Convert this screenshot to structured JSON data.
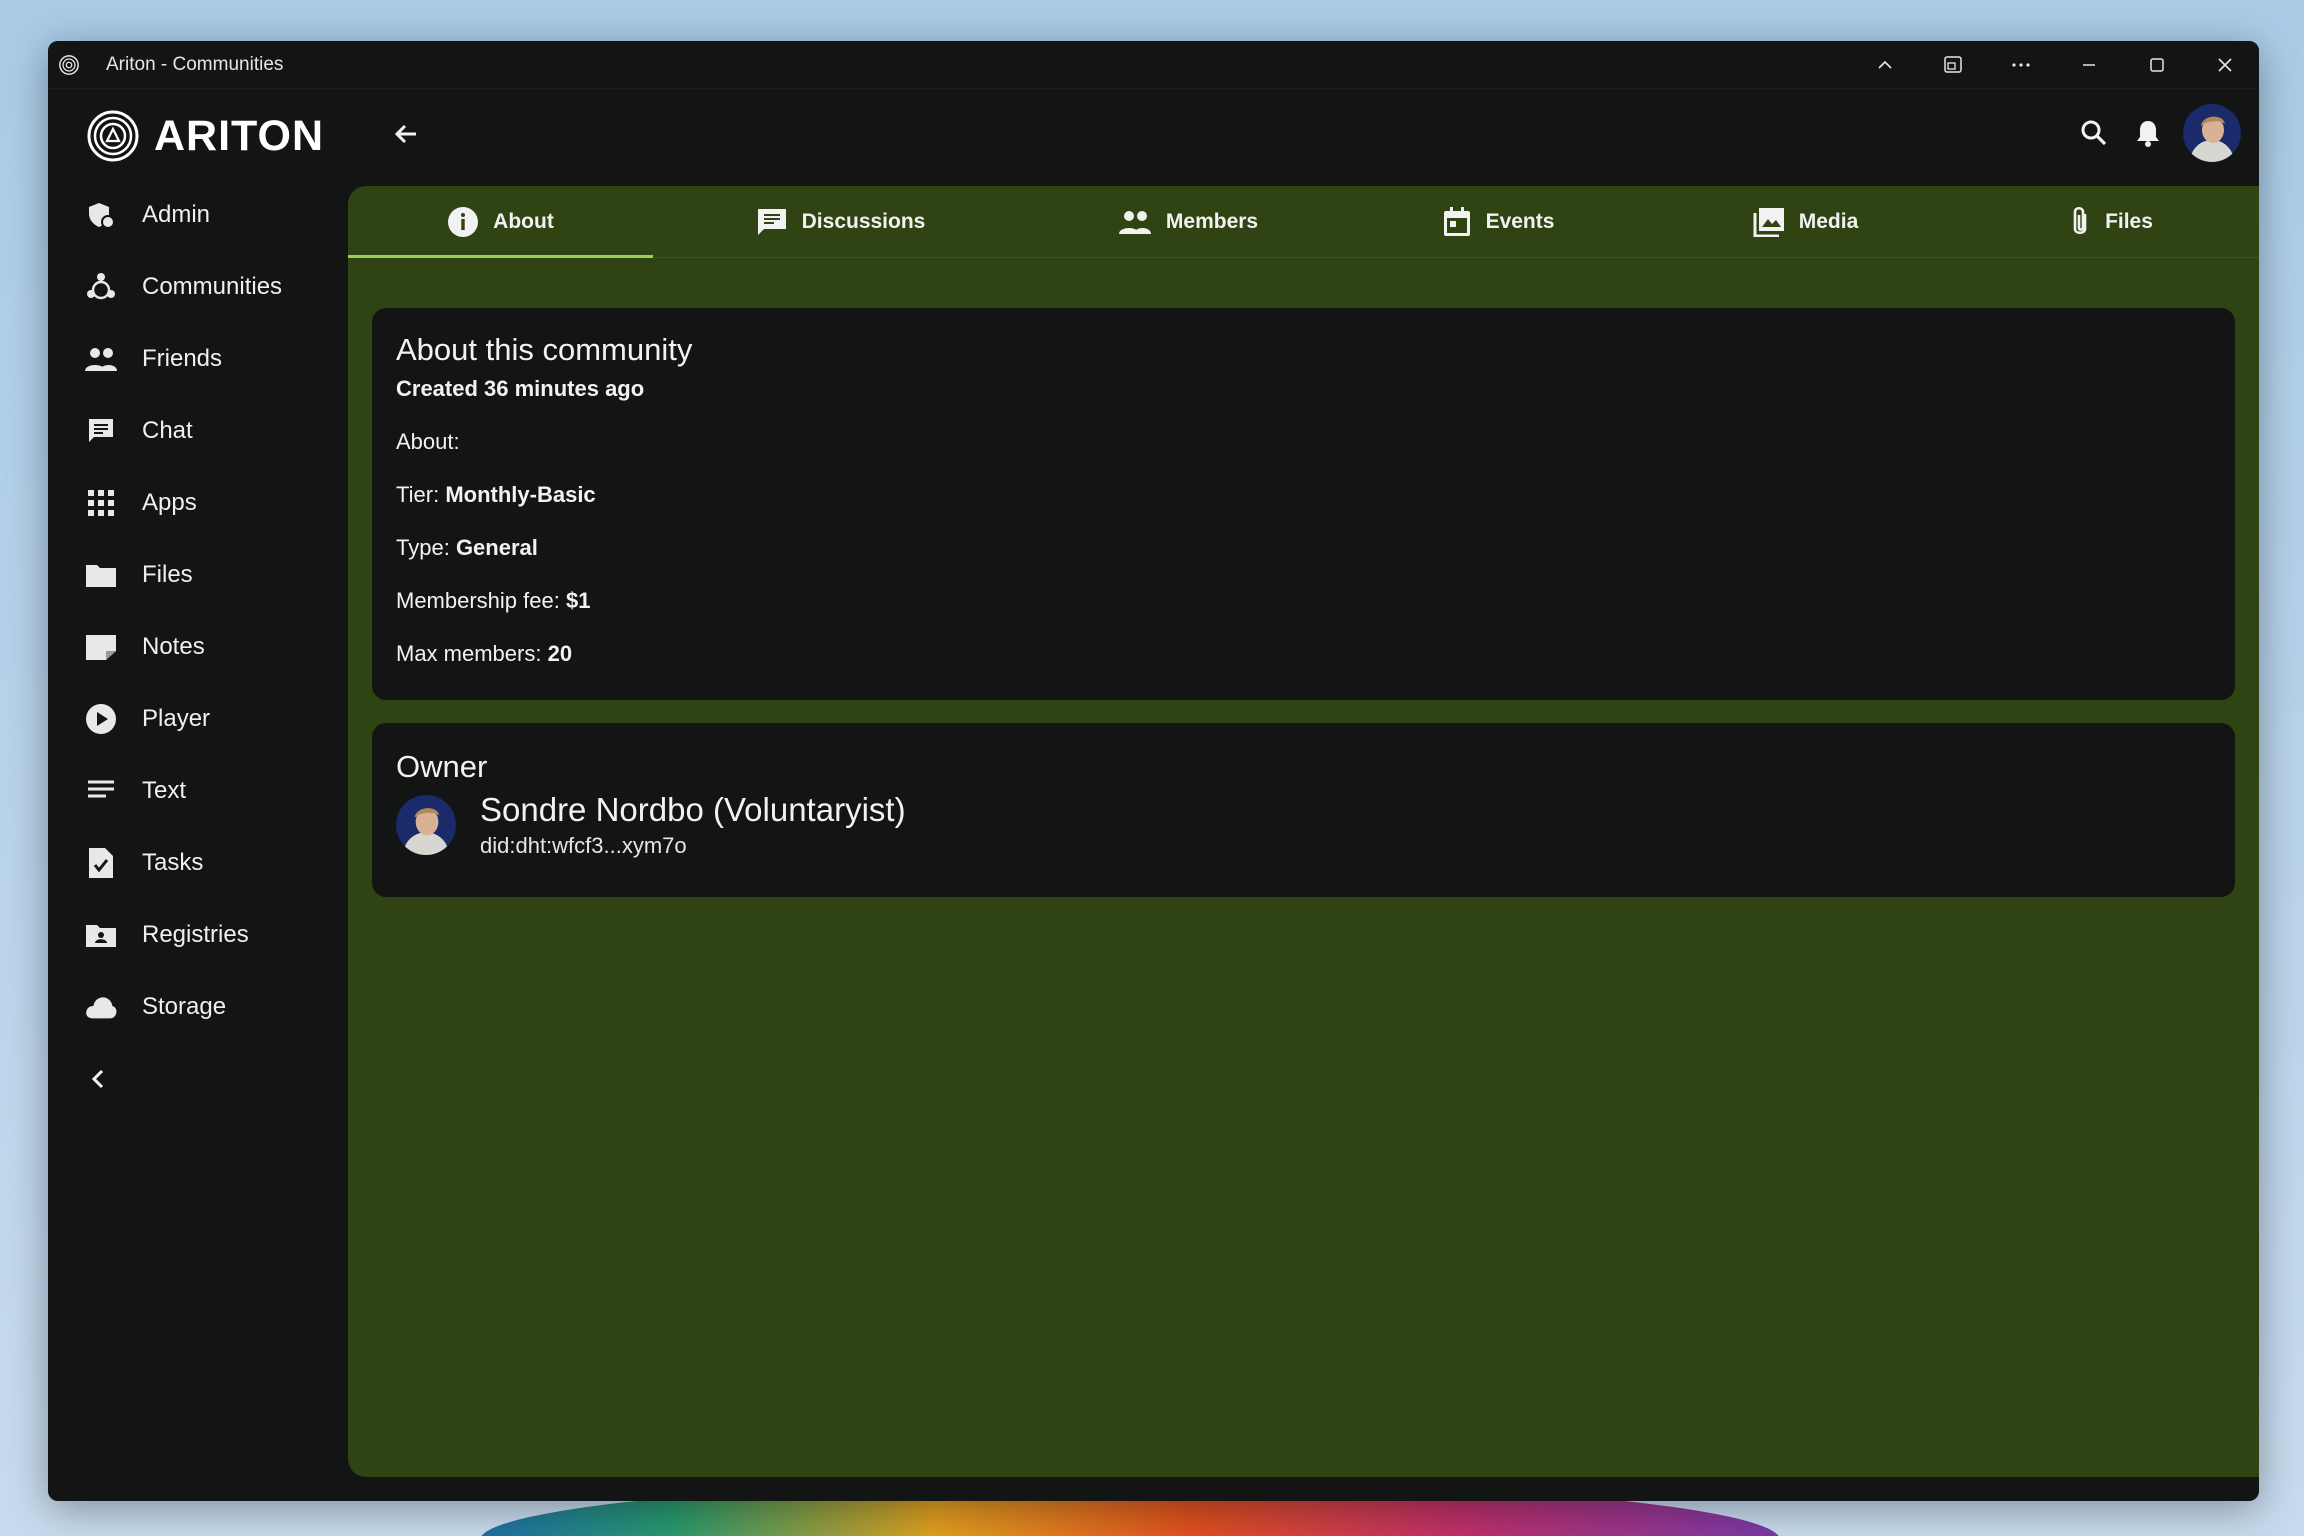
{
  "window": {
    "title": "Ariton - Communities"
  },
  "brand": {
    "name": "ARITON"
  },
  "sidebar": {
    "items": [
      {
        "label": "Admin",
        "icon": "admin-icon"
      },
      {
        "label": "Communities",
        "icon": "communities-icon"
      },
      {
        "label": "Friends",
        "icon": "friends-icon"
      },
      {
        "label": "Chat",
        "icon": "chat-icon"
      },
      {
        "label": "Apps",
        "icon": "apps-grid-icon"
      },
      {
        "label": "Files",
        "icon": "folder-icon"
      },
      {
        "label": "Notes",
        "icon": "note-icon"
      },
      {
        "label": "Player",
        "icon": "play-icon"
      },
      {
        "label": "Text",
        "icon": "text-lines-icon"
      },
      {
        "label": "Tasks",
        "icon": "task-icon"
      },
      {
        "label": "Registries",
        "icon": "registry-icon"
      },
      {
        "label": "Storage",
        "icon": "cloud-icon"
      }
    ]
  },
  "tabs": [
    {
      "label": "About",
      "icon": "info-icon",
      "active": true
    },
    {
      "label": "Discussions",
      "icon": "discussion-icon",
      "active": false
    },
    {
      "label": "Members",
      "icon": "members-icon",
      "active": false
    },
    {
      "label": "Events",
      "icon": "calendar-icon",
      "active": false
    },
    {
      "label": "Media",
      "icon": "media-icon",
      "active": false
    },
    {
      "label": "Files",
      "icon": "paperclip-icon",
      "active": false
    }
  ],
  "about": {
    "heading": "About this community",
    "created": "Created 36 minutes ago",
    "about_label": "About:",
    "tier_label": "Tier:",
    "tier_value": "Monthly-Basic",
    "type_label": "Type:",
    "type_value": "General",
    "fee_label": "Membership fee:",
    "fee_value": "$1",
    "max_label": "Max members:",
    "max_value": "20"
  },
  "owner": {
    "heading": "Owner",
    "name": "Sondre Nordbo (Voluntaryist)",
    "did": "did:dht:wfcf3...xym7o"
  },
  "colors": {
    "content_bg": "#2f4313",
    "card_bg": "#131514",
    "tab_indicator": "#9bd150",
    "window_bg": "#131514"
  }
}
